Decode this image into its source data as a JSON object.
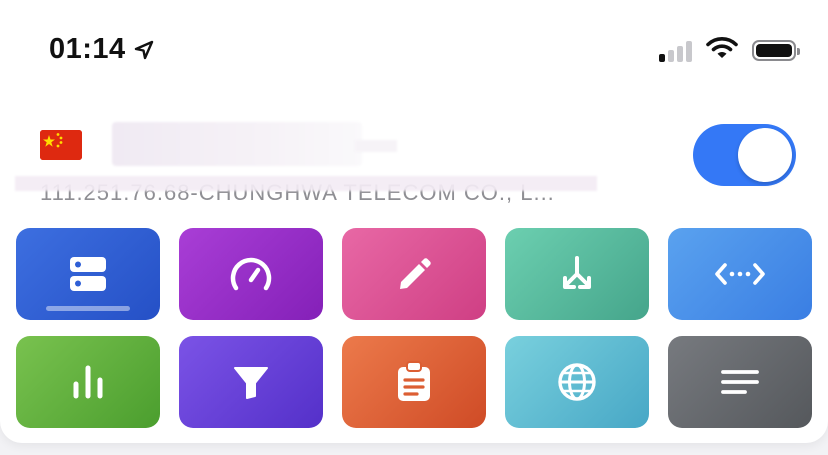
{
  "status_bar": {
    "time": "01:14",
    "location_icon": "location-arrow-icon",
    "signal_bars_active": 1,
    "signal_bars_total": 4,
    "wifi_icon": "wifi-icon",
    "battery_level": 1.0
  },
  "server": {
    "flag": "china-flag-icon",
    "name": "",
    "description": "111.251.76.68-CHUNGHWA TELECOM CO., L...",
    "connected": true
  },
  "tiles": [
    {
      "icon": "server-list-icon",
      "color_from": "#3d6fe0",
      "color_to": "#2550c6"
    },
    {
      "icon": "speedometer-icon",
      "color_from": "#a93ed6",
      "color_to": "#8420b8"
    },
    {
      "icon": "pencil-icon",
      "color_from": "#e868a5",
      "color_to": "#cf3f84"
    },
    {
      "icon": "route-merge-icon",
      "color_from": "#6ccfb0",
      "color_to": "#45a58b"
    },
    {
      "icon": "ellipsis-code-icon",
      "color_from": "#5aa2ef",
      "color_to": "#3a7ee3"
    },
    {
      "icon": "bar-chart-icon",
      "color_from": "#79c24f",
      "color_to": "#4b9e2e"
    },
    {
      "icon": "filter-icon",
      "color_from": "#7b53e6",
      "color_to": "#5430c9"
    },
    {
      "icon": "clipboard-icon",
      "color_from": "#ec7a4b",
      "color_to": "#cf4b26"
    },
    {
      "icon": "globe-icon",
      "color_from": "#79d0dd",
      "color_to": "#47a7c6"
    },
    {
      "icon": "text-lines-icon",
      "color_from": "#777a7f",
      "color_to": "#55585c"
    }
  ]
}
